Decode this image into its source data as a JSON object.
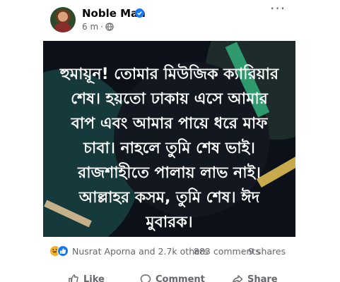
{
  "post": {
    "author": "Noble Man",
    "verified": true,
    "time": "6 m",
    "separator": "·",
    "more_label": "···",
    "privacy_icon": "globe-icon"
  },
  "image_text": "হুমায়ূন! তোমার মিউজিক ক্যারিয়ার শেষ। হয়তো ঢাকায় এসে আমার বাপ এবং আমার পায়ে ধরে মাফ চাবা। নাহলে তুমি শেষ ভাই। রাজশাহীতে পালায় লাভ নাই। আল্লাহর কসম, তুমি শেষ। ঈদ মুবারক।",
  "stats": {
    "reactions": [
      "haha-icon",
      "like-icon"
    ],
    "reactors": "Nusrat Aporna and 2.7k others",
    "comments": "883 comments",
    "dot": "·",
    "shares": "9 shares"
  },
  "actions": {
    "like": "Like",
    "comment": "Comment",
    "share": "Share"
  },
  "colors": {
    "accent": "#1877f2",
    "muted": "#65676b",
    "image_bg": "#0c1018"
  }
}
